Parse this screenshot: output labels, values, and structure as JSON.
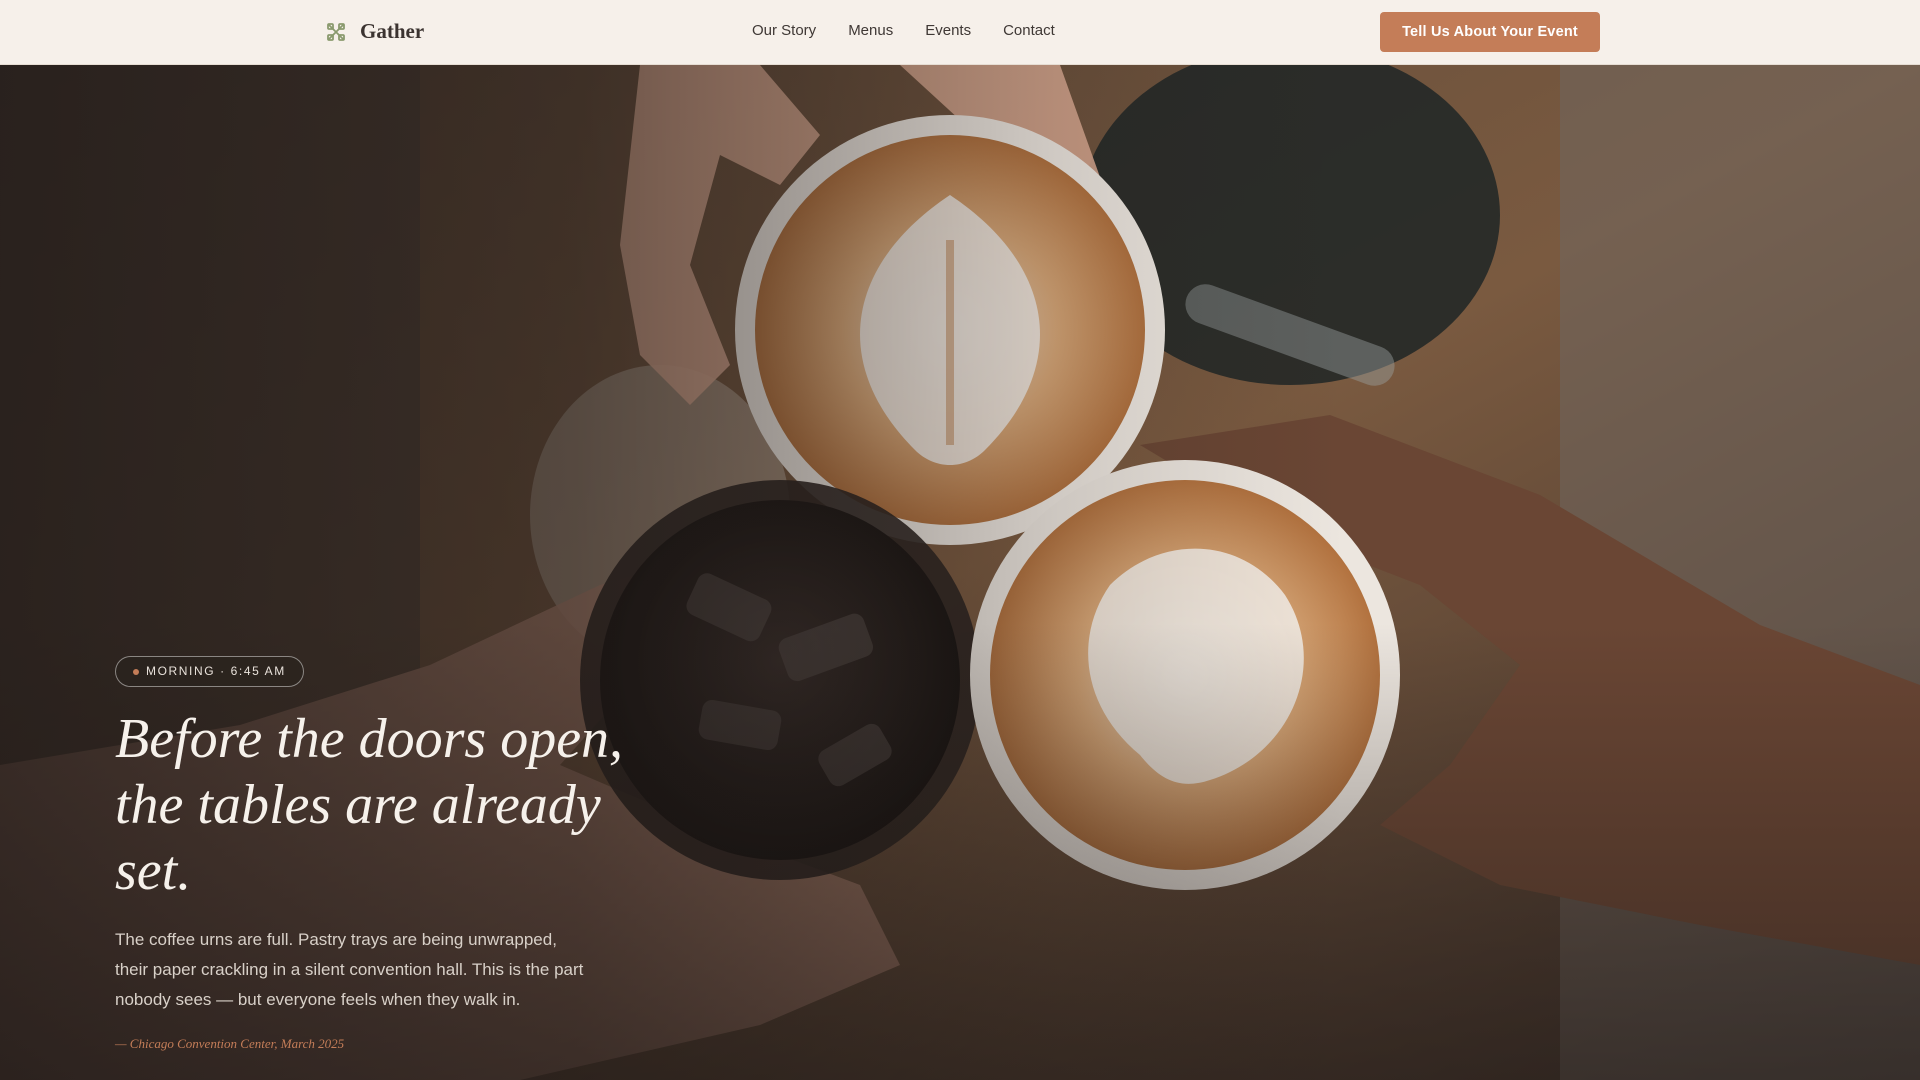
{
  "nav": {
    "brand": "Gather",
    "links": [
      "Our Story",
      "Menus",
      "Events",
      "Contact"
    ],
    "cta": "Tell Us About Your Event"
  },
  "hero": {
    "badge": "MORNING · 6:45 AM",
    "headline": "Before the doors open, the tables are already set.",
    "body": "The coffee urns are full. Pastry trays are being unwrapped, their paper crackling in a silent convention hall. This is the part nobody sees — but everyone feels when they walk in.",
    "caption": "— Chicago Convention Center, March 2025"
  },
  "colors": {
    "accent": "#c47d58",
    "nav_bg": "#f6f0ea",
    "text_dark": "#3b3330",
    "headline": "#f6f1eb"
  },
  "icons": {
    "brand": "knot-icon"
  }
}
